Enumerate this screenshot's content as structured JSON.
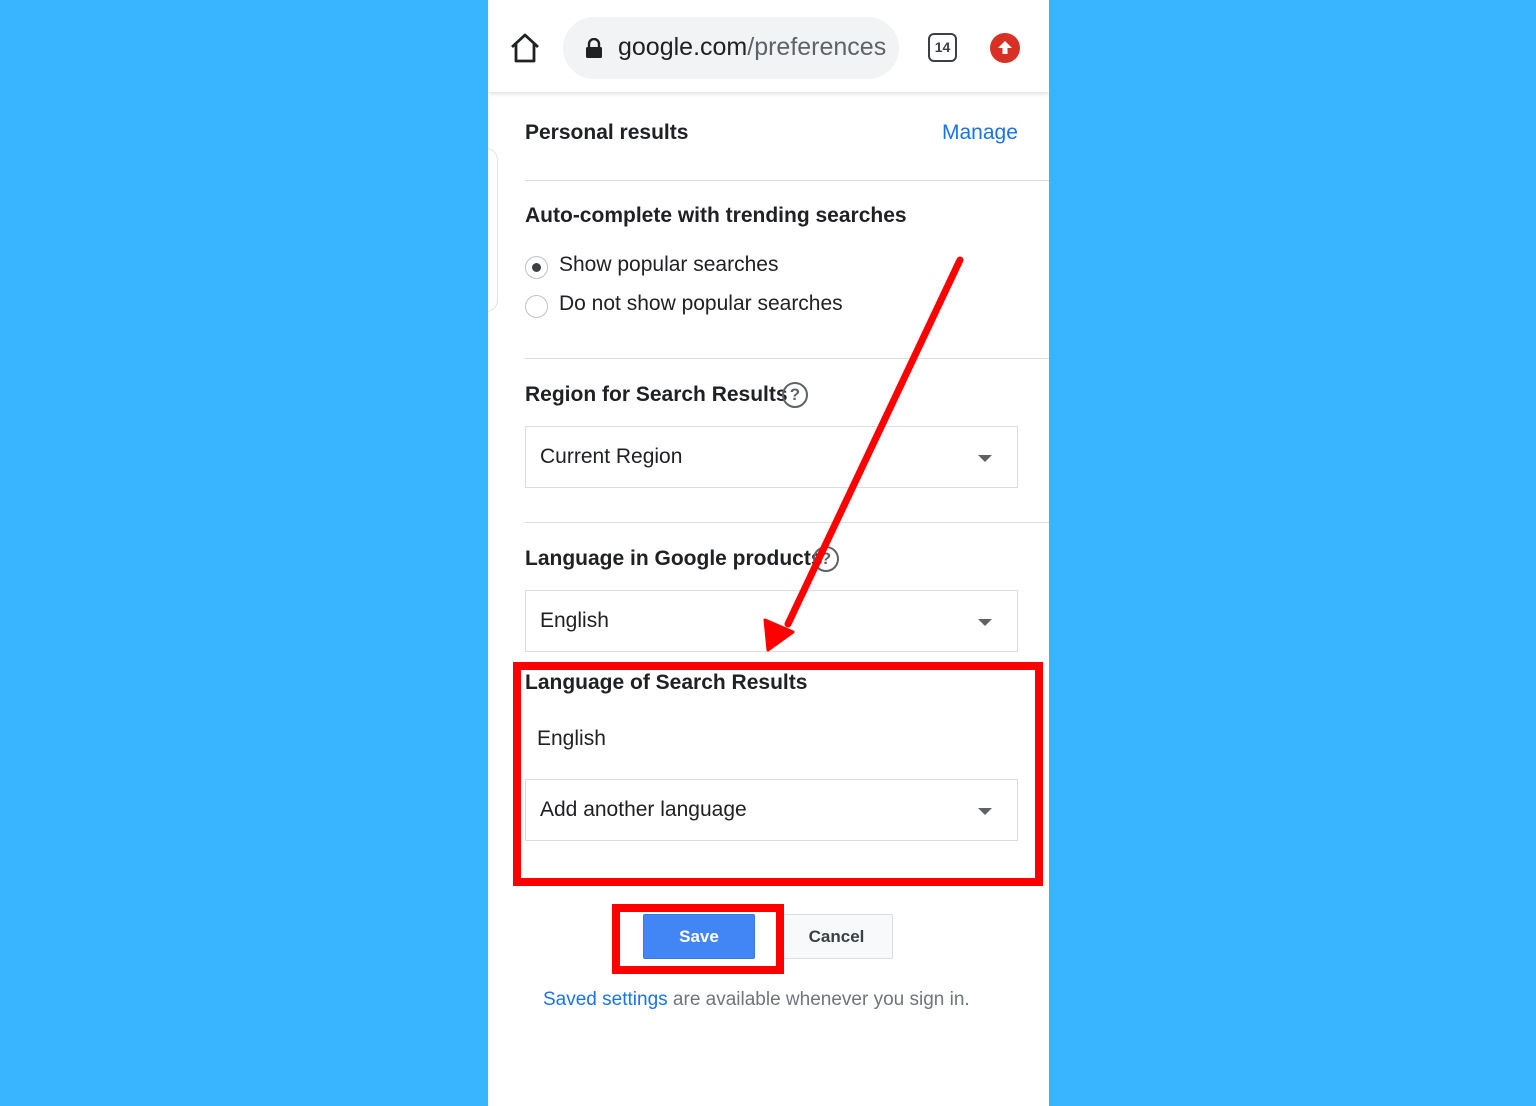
{
  "browser": {
    "url_domain": "google.com",
    "url_path": "/preferences",
    "tab_count": "14"
  },
  "personal_results": {
    "title": "Personal results",
    "manage_link": "Manage"
  },
  "autocomplete": {
    "title": "Auto-complete with trending searches",
    "options": [
      {
        "label": "Show popular searches",
        "checked": true
      },
      {
        "label": "Do not show popular searches",
        "checked": false
      }
    ]
  },
  "region": {
    "title": "Region for Search Results",
    "selected": "Current Region"
  },
  "language_products": {
    "title": "Language in Google products",
    "selected": "English"
  },
  "language_results": {
    "title": "Language of Search Results",
    "current": "English",
    "add_placeholder": "Add another language"
  },
  "actions": {
    "save_label": "Save",
    "cancel_label": "Cancel"
  },
  "footer": {
    "link_text": "Saved settings",
    "rest_text": " are available whenever you sign in."
  },
  "help_glyph": "?",
  "colors": {
    "background": "#39b4fe",
    "link": "#1a73e8",
    "primary_button": "#4285f4",
    "annotation": "#ff0000"
  }
}
